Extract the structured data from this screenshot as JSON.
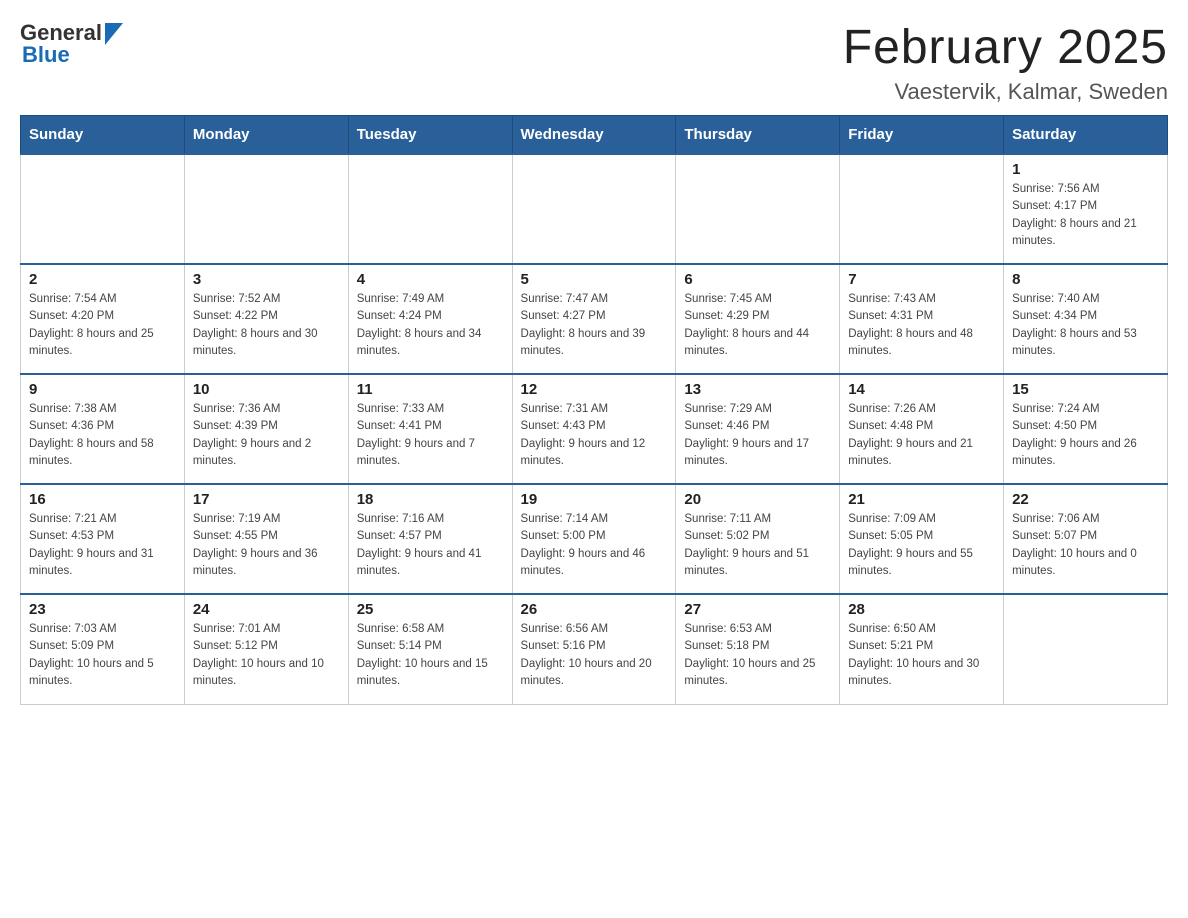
{
  "header": {
    "logo_general": "General",
    "logo_blue": "Blue",
    "month_title": "February 2025",
    "location": "Vaestervik, Kalmar, Sweden"
  },
  "weekdays": [
    "Sunday",
    "Monday",
    "Tuesday",
    "Wednesday",
    "Thursday",
    "Friday",
    "Saturday"
  ],
  "weeks": [
    [
      {
        "day": "",
        "sunrise": "",
        "sunset": "",
        "daylight": "",
        "empty": true
      },
      {
        "day": "",
        "sunrise": "",
        "sunset": "",
        "daylight": "",
        "empty": true
      },
      {
        "day": "",
        "sunrise": "",
        "sunset": "",
        "daylight": "",
        "empty": true
      },
      {
        "day": "",
        "sunrise": "",
        "sunset": "",
        "daylight": "",
        "empty": true
      },
      {
        "day": "",
        "sunrise": "",
        "sunset": "",
        "daylight": "",
        "empty": true
      },
      {
        "day": "",
        "sunrise": "",
        "sunset": "",
        "daylight": "",
        "empty": true
      },
      {
        "day": "1",
        "sunrise": "Sunrise: 7:56 AM",
        "sunset": "Sunset: 4:17 PM",
        "daylight": "Daylight: 8 hours and 21 minutes.",
        "empty": false
      }
    ],
    [
      {
        "day": "2",
        "sunrise": "Sunrise: 7:54 AM",
        "sunset": "Sunset: 4:20 PM",
        "daylight": "Daylight: 8 hours and 25 minutes.",
        "empty": false
      },
      {
        "day": "3",
        "sunrise": "Sunrise: 7:52 AM",
        "sunset": "Sunset: 4:22 PM",
        "daylight": "Daylight: 8 hours and 30 minutes.",
        "empty": false
      },
      {
        "day": "4",
        "sunrise": "Sunrise: 7:49 AM",
        "sunset": "Sunset: 4:24 PM",
        "daylight": "Daylight: 8 hours and 34 minutes.",
        "empty": false
      },
      {
        "day": "5",
        "sunrise": "Sunrise: 7:47 AM",
        "sunset": "Sunset: 4:27 PM",
        "daylight": "Daylight: 8 hours and 39 minutes.",
        "empty": false
      },
      {
        "day": "6",
        "sunrise": "Sunrise: 7:45 AM",
        "sunset": "Sunset: 4:29 PM",
        "daylight": "Daylight: 8 hours and 44 minutes.",
        "empty": false
      },
      {
        "day": "7",
        "sunrise": "Sunrise: 7:43 AM",
        "sunset": "Sunset: 4:31 PM",
        "daylight": "Daylight: 8 hours and 48 minutes.",
        "empty": false
      },
      {
        "day": "8",
        "sunrise": "Sunrise: 7:40 AM",
        "sunset": "Sunset: 4:34 PM",
        "daylight": "Daylight: 8 hours and 53 minutes.",
        "empty": false
      }
    ],
    [
      {
        "day": "9",
        "sunrise": "Sunrise: 7:38 AM",
        "sunset": "Sunset: 4:36 PM",
        "daylight": "Daylight: 8 hours and 58 minutes.",
        "empty": false
      },
      {
        "day": "10",
        "sunrise": "Sunrise: 7:36 AM",
        "sunset": "Sunset: 4:39 PM",
        "daylight": "Daylight: 9 hours and 2 minutes.",
        "empty": false
      },
      {
        "day": "11",
        "sunrise": "Sunrise: 7:33 AM",
        "sunset": "Sunset: 4:41 PM",
        "daylight": "Daylight: 9 hours and 7 minutes.",
        "empty": false
      },
      {
        "day": "12",
        "sunrise": "Sunrise: 7:31 AM",
        "sunset": "Sunset: 4:43 PM",
        "daylight": "Daylight: 9 hours and 12 minutes.",
        "empty": false
      },
      {
        "day": "13",
        "sunrise": "Sunrise: 7:29 AM",
        "sunset": "Sunset: 4:46 PM",
        "daylight": "Daylight: 9 hours and 17 minutes.",
        "empty": false
      },
      {
        "day": "14",
        "sunrise": "Sunrise: 7:26 AM",
        "sunset": "Sunset: 4:48 PM",
        "daylight": "Daylight: 9 hours and 21 minutes.",
        "empty": false
      },
      {
        "day": "15",
        "sunrise": "Sunrise: 7:24 AM",
        "sunset": "Sunset: 4:50 PM",
        "daylight": "Daylight: 9 hours and 26 minutes.",
        "empty": false
      }
    ],
    [
      {
        "day": "16",
        "sunrise": "Sunrise: 7:21 AM",
        "sunset": "Sunset: 4:53 PM",
        "daylight": "Daylight: 9 hours and 31 minutes.",
        "empty": false
      },
      {
        "day": "17",
        "sunrise": "Sunrise: 7:19 AM",
        "sunset": "Sunset: 4:55 PM",
        "daylight": "Daylight: 9 hours and 36 minutes.",
        "empty": false
      },
      {
        "day": "18",
        "sunrise": "Sunrise: 7:16 AM",
        "sunset": "Sunset: 4:57 PM",
        "daylight": "Daylight: 9 hours and 41 minutes.",
        "empty": false
      },
      {
        "day": "19",
        "sunrise": "Sunrise: 7:14 AM",
        "sunset": "Sunset: 5:00 PM",
        "daylight": "Daylight: 9 hours and 46 minutes.",
        "empty": false
      },
      {
        "day": "20",
        "sunrise": "Sunrise: 7:11 AM",
        "sunset": "Sunset: 5:02 PM",
        "daylight": "Daylight: 9 hours and 51 minutes.",
        "empty": false
      },
      {
        "day": "21",
        "sunrise": "Sunrise: 7:09 AM",
        "sunset": "Sunset: 5:05 PM",
        "daylight": "Daylight: 9 hours and 55 minutes.",
        "empty": false
      },
      {
        "day": "22",
        "sunrise": "Sunrise: 7:06 AM",
        "sunset": "Sunset: 5:07 PM",
        "daylight": "Daylight: 10 hours and 0 minutes.",
        "empty": false
      }
    ],
    [
      {
        "day": "23",
        "sunrise": "Sunrise: 7:03 AM",
        "sunset": "Sunset: 5:09 PM",
        "daylight": "Daylight: 10 hours and 5 minutes.",
        "empty": false
      },
      {
        "day": "24",
        "sunrise": "Sunrise: 7:01 AM",
        "sunset": "Sunset: 5:12 PM",
        "daylight": "Daylight: 10 hours and 10 minutes.",
        "empty": false
      },
      {
        "day": "25",
        "sunrise": "Sunrise: 6:58 AM",
        "sunset": "Sunset: 5:14 PM",
        "daylight": "Daylight: 10 hours and 15 minutes.",
        "empty": false
      },
      {
        "day": "26",
        "sunrise": "Sunrise: 6:56 AM",
        "sunset": "Sunset: 5:16 PM",
        "daylight": "Daylight: 10 hours and 20 minutes.",
        "empty": false
      },
      {
        "day": "27",
        "sunrise": "Sunrise: 6:53 AM",
        "sunset": "Sunset: 5:18 PM",
        "daylight": "Daylight: 10 hours and 25 minutes.",
        "empty": false
      },
      {
        "day": "28",
        "sunrise": "Sunrise: 6:50 AM",
        "sunset": "Sunset: 5:21 PM",
        "daylight": "Daylight: 10 hours and 30 minutes.",
        "empty": false
      },
      {
        "day": "",
        "sunrise": "",
        "sunset": "",
        "daylight": "",
        "empty": true
      }
    ]
  ]
}
